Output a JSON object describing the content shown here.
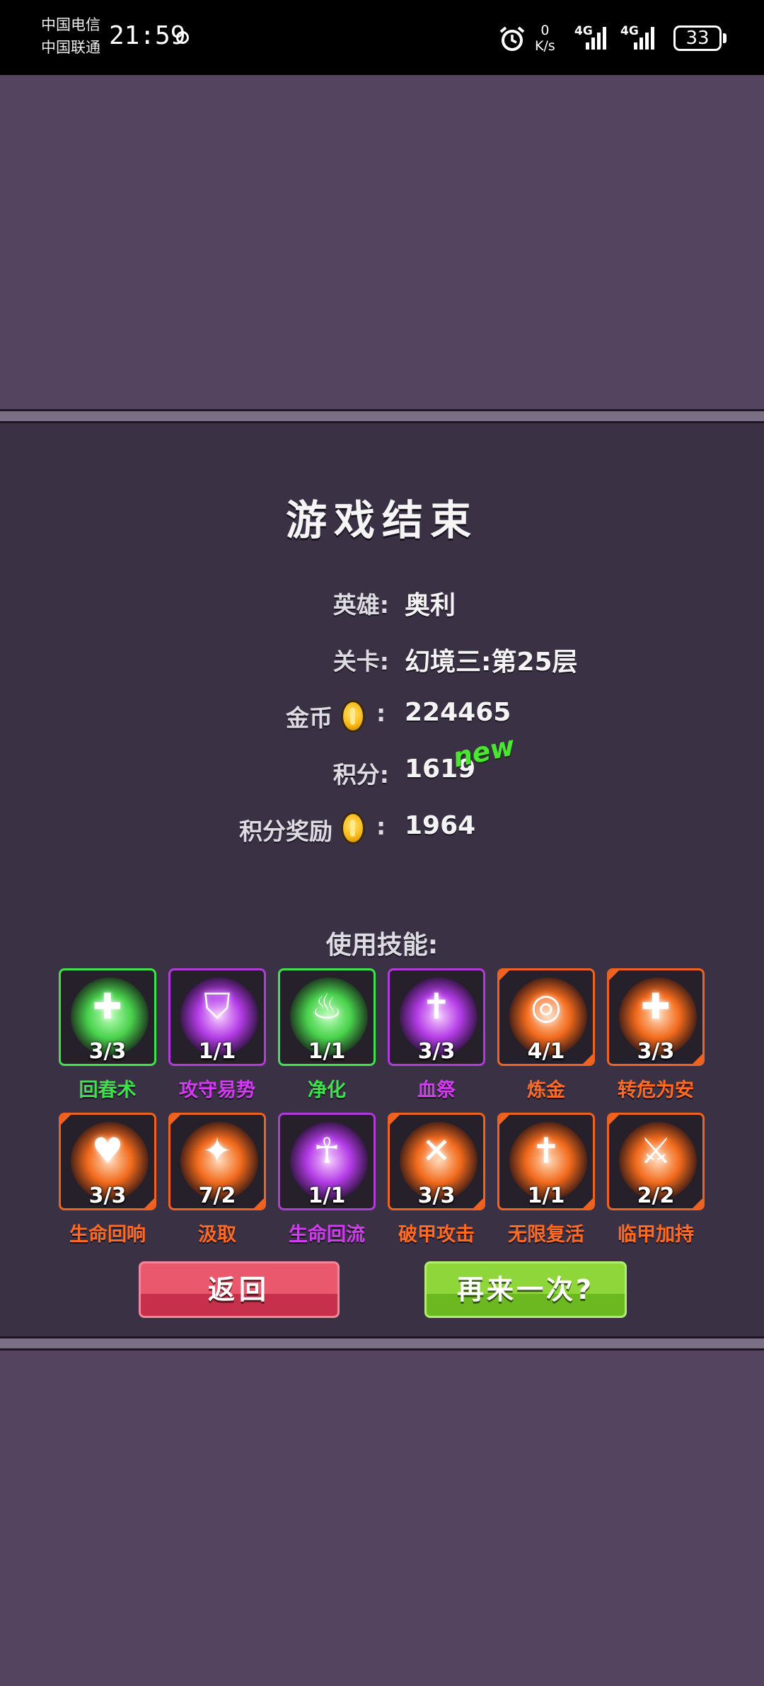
{
  "status_bar": {
    "carrier1": "中国电信",
    "carrier2": "中国联通",
    "time": "21:59",
    "net_speed_value": "0",
    "net_speed_unit": "K/s",
    "signal1_label": "4G",
    "signal2_label": "4G",
    "battery": "33"
  },
  "game_over": {
    "title": "游戏结束",
    "hero_label": "英雄:",
    "hero_value": "奥利",
    "level_label": "关卡:",
    "level_value": "幻境三:第25层",
    "gold_label": "金币",
    "gold_value": "224465",
    "score_label": "积分:",
    "score_value": "1619",
    "new_badge": "new",
    "reward_label": "积分奖励",
    "reward_value": "1964",
    "colon": ":"
  },
  "skills_heading": "使用技能:",
  "skills": [
    {
      "name": "回春术",
      "count": "3/3",
      "color": "green",
      "icon": "heal-plus-icon",
      "glyph": "✚"
    },
    {
      "name": "攻守易势",
      "count": "1/1",
      "color": "purple",
      "icon": "shield-swap-icon",
      "glyph": "⛉"
    },
    {
      "name": "净化",
      "count": "1/1",
      "color": "green",
      "icon": "purify-flame-icon",
      "glyph": "♨"
    },
    {
      "name": "血祭",
      "count": "3/3",
      "color": "purple",
      "icon": "blood-drop-icon",
      "glyph": "✝"
    },
    {
      "name": "炼金",
      "count": "4/1",
      "color": "orange",
      "icon": "alchemy-target-icon",
      "glyph": "◎"
    },
    {
      "name": "转危为安",
      "count": "3/3",
      "color": "orange",
      "icon": "escape-runner-icon",
      "glyph": "✚"
    },
    {
      "name": "生命回响",
      "count": "3/3",
      "color": "orange",
      "icon": "flex-arm-icon",
      "glyph": "♥"
    },
    {
      "name": "汲取",
      "count": "7/2",
      "color": "orange",
      "icon": "drain-figure-icon",
      "glyph": "✦"
    },
    {
      "name": "生命回流",
      "count": "1/1",
      "color": "purple",
      "icon": "spirit-figure-icon",
      "glyph": "☥"
    },
    {
      "name": "破甲攻击",
      "count": "3/3",
      "color": "orange",
      "icon": "pierce-strike-icon",
      "glyph": "✕"
    },
    {
      "name": "无限复活",
      "count": "1/1",
      "color": "orange",
      "icon": "revive-cross-icon",
      "glyph": "✝"
    },
    {
      "name": "临甲加持",
      "count": "2/2",
      "color": "orange",
      "icon": "armor-runner-icon",
      "glyph": "⚔"
    }
  ],
  "buttons": {
    "back": "返回",
    "retry": "再来一次?"
  },
  "colors": {
    "background": "#55445f",
    "panel": "#3b3145",
    "green": "#3ee24b",
    "purple": "#b23ad8",
    "orange": "#f06220",
    "back_button": "#e9586c",
    "retry_button": "#8ed63a",
    "new_badge": "#4be631"
  }
}
